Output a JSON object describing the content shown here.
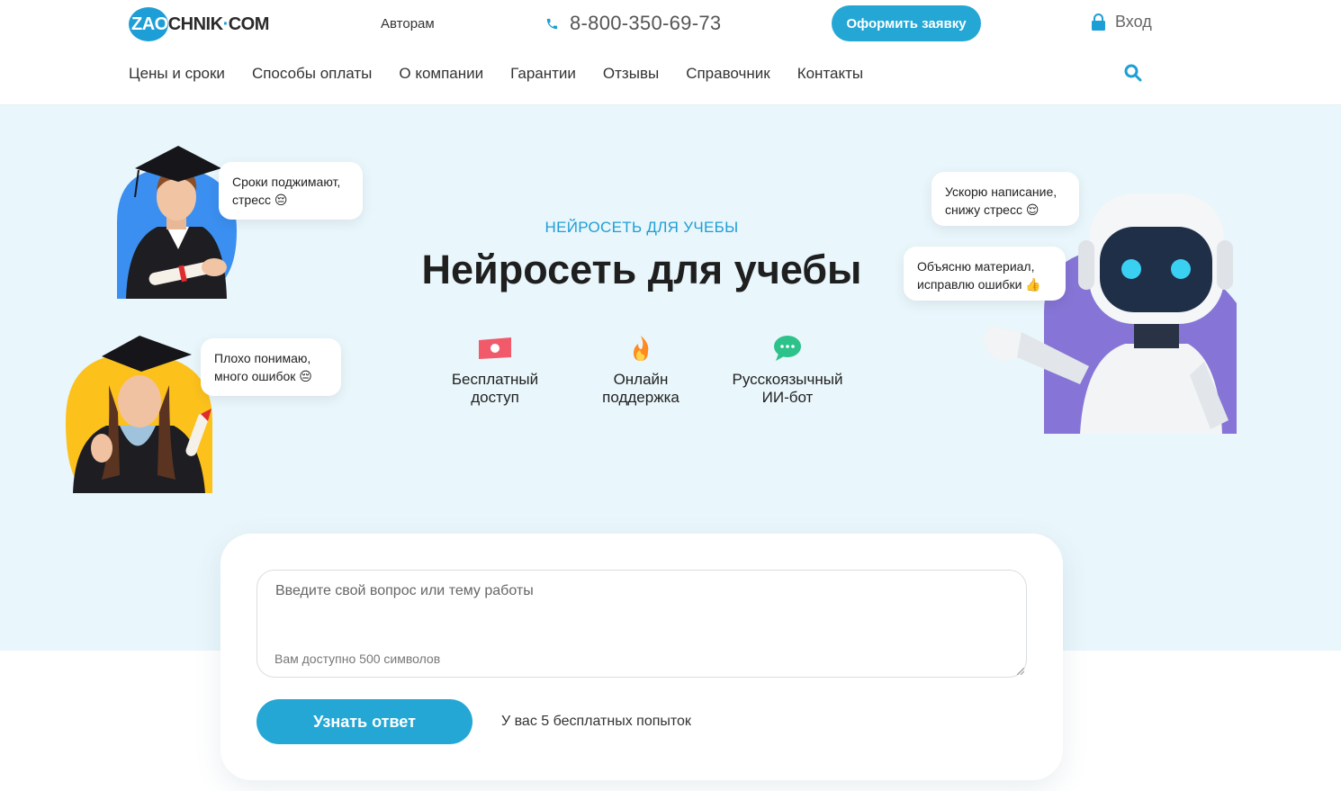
{
  "header": {
    "logo": {
      "part1": "ZAO",
      "part2": "CHNIK",
      "dot": "·",
      "part3": "COM"
    },
    "authors_link": "Авторам",
    "phone": "8-800-350-69-73",
    "order_button": "Оформить заявку",
    "login": "Вход",
    "nav": [
      "Цены и сроки",
      "Способы оплаты",
      "О компании",
      "Гарантии",
      "Отзывы",
      "Справочник",
      "Контакты"
    ]
  },
  "hero": {
    "eyebrow": "НЕЙРОСЕТЬ ДЛЯ УЧЕБЫ",
    "title": "Нейросеть для учебы",
    "bubbles": {
      "student_male": {
        "line1": "Сроки поджимают,",
        "line2": "стресс 😔"
      },
      "student_female": {
        "line1": "Плохо понимаю,",
        "line2": "много ошибок 😔"
      },
      "robot_top": {
        "line1": "Ускорю написание,",
        "line2": "снижу стресс 😌"
      },
      "robot_bottom": {
        "line1": "Объясню материал,",
        "line2": "исправлю ошибки 👍"
      }
    },
    "features": [
      {
        "line1": "Бесплатный",
        "line2": "доступ",
        "icon": "money-icon"
      },
      {
        "line1": "Онлайн",
        "line2": "поддержка",
        "icon": "fire-icon"
      },
      {
        "line1": "Русскоязычный",
        "line2": "ИИ-бот",
        "icon": "chat-icon"
      }
    ]
  },
  "form": {
    "placeholder": "Введите свой вопрос или тему работы",
    "char_hint": "Вам доступно 500 символов",
    "submit": "Узнать ответ",
    "attempts": "У вас 5 бесплатных попыток"
  },
  "colors": {
    "accent": "#24a7d5",
    "hero_bg": "#e9f6fb"
  }
}
